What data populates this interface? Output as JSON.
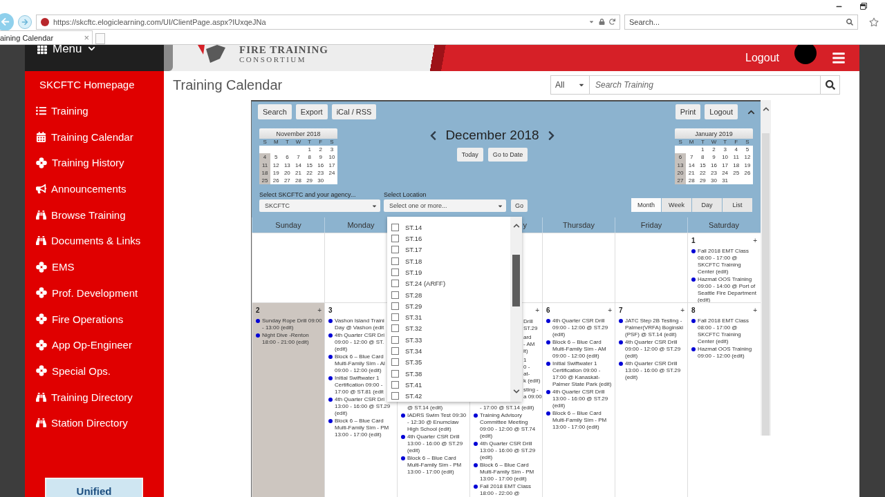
{
  "browser": {
    "url": "https://skcftc.elogiclearning.com/UI/ClientPage.aspx?IUxqeJNa",
    "search_placeholder": "Search...",
    "tab_title": "aining Calendar",
    "tab_close": "×"
  },
  "header": {
    "menu": "Menu",
    "logo_line1": "FIRE TRAINING",
    "logo_line2": "CONSORTIUM",
    "logout": "Logout"
  },
  "sidebar": {
    "items": [
      {
        "label": "SKCFTC Homepage",
        "kind": "plain"
      },
      {
        "label": "Training",
        "kind": "list"
      },
      {
        "label": "Training Calendar",
        "kind": "calendar"
      },
      {
        "label": "Training History",
        "kind": "cross"
      },
      {
        "label": "Announcements",
        "kind": "megaphone"
      },
      {
        "label": "Browse Training",
        "kind": "binoculars"
      },
      {
        "label": "Documents & Links",
        "kind": "binoculars"
      },
      {
        "label": "EMS",
        "kind": "cross"
      },
      {
        "label": "Prof. Development",
        "kind": "cross"
      },
      {
        "label": "Fire Operations",
        "kind": "cross"
      },
      {
        "label": "App Op-Engineer",
        "kind": "cross"
      },
      {
        "label": "Special Ops.",
        "kind": "cross"
      },
      {
        "label": "Training Directory",
        "kind": "binoculars"
      },
      {
        "label": "Station Directory",
        "kind": "binoculars"
      }
    ],
    "footer": "Unified"
  },
  "page": {
    "title": "Training Calendar",
    "scope": "All",
    "search_placeholder": "Search Training"
  },
  "calendar": {
    "toolbar_left": [
      "Search",
      "Export",
      "iCal / RSS"
    ],
    "toolbar_right": [
      "Print",
      "Logout"
    ],
    "month": "December 2018",
    "today": "Today",
    "goto": "Go to Date",
    "mini_calendars": [
      {
        "title": "November 2018",
        "weekdays": [
          "S",
          "M",
          "T",
          "W",
          "T",
          "F",
          "S"
        ],
        "weeks": [
          {
            "kind": "leading",
            "days": [
              "1",
              "2",
              "3"
            ]
          },
          {
            "shaded": true,
            "days": [
              "4",
              "5",
              "6",
              "7",
              "8",
              "9",
              "10"
            ]
          },
          {
            "shaded": true,
            "days": [
              "11",
              "12",
              "13",
              "14",
              "15",
              "16",
              "17"
            ]
          },
          {
            "shaded": true,
            "days": [
              "18",
              "19",
              "20",
              "21",
              "22",
              "23",
              "24"
            ]
          },
          {
            "shaded": true,
            "days": [
              "25",
              "26",
              "27",
              "28",
              "29",
              "30"
            ]
          }
        ]
      },
      {
        "title": "January 2019",
        "weekdays": [
          "S",
          "M",
          "T",
          "W",
          "T",
          "F",
          "S"
        ],
        "weeks": [
          {
            "kind": "leading",
            "days": [
              "1",
              "2",
              "3",
              "4",
              "5"
            ]
          },
          {
            "shaded": true,
            "days": [
              "6",
              "7",
              "8",
              "9",
              "10",
              "11",
              "12"
            ]
          },
          {
            "shaded": true,
            "days": [
              "13",
              "14",
              "15",
              "16",
              "17",
              "18",
              "19"
            ]
          },
          {
            "shaded": true,
            "days": [
              "20",
              "21",
              "22",
              "23",
              "24",
              "25",
              "26"
            ]
          },
          {
            "shaded": true,
            "days": [
              "27",
              "28",
              "29",
              "30",
              "31"
            ]
          }
        ]
      }
    ],
    "agency": {
      "label": "Select SKCFTC and your agency...",
      "value": "SKCFTC"
    },
    "location": {
      "label": "Select Location",
      "placeholder": "Select one or more..."
    },
    "go": "Go",
    "views": [
      {
        "label": "Month",
        "selected": true
      },
      {
        "label": "Week",
        "selected": false
      },
      {
        "label": "Day",
        "selected": false
      },
      {
        "label": "List",
        "selected": false
      }
    ],
    "day_headers": [
      {
        "label": "Sunday",
        "cut": false
      },
      {
        "label": "Monday",
        "cut": false
      },
      {
        "label": "y",
        "cut": true
      },
      {
        "label": "Thursday",
        "cut": false
      },
      {
        "label": "Friday",
        "cut": false
      },
      {
        "label": "Saturday",
        "cut": false
      }
    ],
    "weeks": [
      {
        "cells": [
          {},
          {},
          {},
          {},
          {},
          {},
          {
            "date": "1",
            "add": "+",
            "shaded": false,
            "events": [
              {
                "kind": "event",
                "lines": [
                  "Fall 2018 EMT Class",
                  "08:00 - 17:00 @",
                  "SKCFTC Training",
                  "Center (edit)"
                ]
              },
              {
                "kind": "event",
                "lines": [
                  "Hazmat OOS Training",
                  "09:00 - 14:00 @ Port of",
                  "Seattle Fire Department",
                  "(edit)"
                ]
              }
            ]
          }
        ]
      },
      {
        "cells": [
          {
            "date": "2",
            "add": "+",
            "shaded": true,
            "events": [
              {
                "kind": "event",
                "lines": [
                  "Sunday Rope Drill 09:00",
                  "- 13:00 (edit)"
                ]
              },
              {
                "kind": "event",
                "lines": [
                  "Night Dive -Renton",
                  "18:00 - 21:00 (edit)"
                ]
              }
            ]
          },
          {
            "date": "3",
            "shaded": false,
            "events": [
              {
                "kind": "event",
                "lines": [
                  "Vashon Island Traini",
                  "Day @ Vashon (edit"
                ]
              },
              {
                "kind": "event",
                "lines": [
                  "4th Quarter CSR Dri",
                  "09:00 - 12:00 @ ST.",
                  "(edit)"
                ]
              },
              {
                "kind": "event",
                "lines": [
                  "Block 6 – Blue Card",
                  "Multi-Family Sim - Al",
                  "09:00 - 12:00 (edit)"
                ]
              },
              {
                "kind": "event",
                "lines": [
                  "Initial Swiftwater 1",
                  "Certification 09:00 -",
                  "17:00 @ ST.81 (edit"
                ]
              },
              {
                "kind": "event",
                "lines": [
                  "4th Quarter CSR Dri",
                  "13:00 - 16:00 @ ST.29",
                  "(edit)"
                ]
              },
              {
                "kind": "event",
                "lines": [
                  "Block 6 – Blue Card",
                  "Multi-Family Sim - PM",
                  "13:00 - 17:00 (edit)"
                ]
              }
            ]
          },
          {
            "covered": true,
            "shaded": false,
            "events": [
              {
                "kind": "continuation",
                "lines": [
                  "@ ST.14 (edit)"
                ]
              },
              {
                "kind": "event",
                "lines": [
                  "IADRS Swim Test 09:30",
                  "- 12:30 @ Enumclaw",
                  "High School (edit)"
                ]
              },
              {
                "kind": "event",
                "lines": [
                  "4th Quarter CSR Drill",
                  "13:00 - 16:00 @ ST.29",
                  "(edit)"
                ]
              },
              {
                "kind": "event",
                "lines": [
                  "Block 6 – Blue Card",
                  "Multi-Family Sim - PM",
                  "13:00 - 17:00 (edit)"
                ]
              }
            ]
          },
          {
            "covered": true,
            "add": "+",
            "shaded": false,
            "fragments": [
              {
                "lines": [
                  "Drill",
                  "ST.29"
                ]
              },
              {
                "lines": [
                  "ard",
                  "- AM",
                  "it)"
                ]
              },
              {
                "lines": [
                  "1",
                  "0 -",
                  "at-",
                  "k (edit)"
                ]
              },
              {
                "lines": [
                  "sting -",
                  "a 09:00"
                ]
              }
            ],
            "events": [
              {
                "kind": "continuation",
                "lines": [
                  "- 17:00 @ ST.14 (edit)"
                ]
              },
              {
                "kind": "event",
                "lines": [
                  "Training Advisory",
                  "Committee Meeting",
                  "09:00 - 12:00 @ ST.74",
                  "(edit)"
                ]
              },
              {
                "kind": "event",
                "lines": [
                  "4th Quarter CSR Drill",
                  "13:00 - 16:00 @ ST.29",
                  "(edit)"
                ]
              },
              {
                "kind": "event",
                "lines": [
                  "Block 6 – Blue Card",
                  "Multi-Family Sim - PM",
                  "13:00 - 17:00 (edit)"
                ]
              },
              {
                "kind": "event",
                "lines": [
                  "Fall 2018 EMT Class",
                  "18:00 - 22:00 @"
                ]
              }
            ]
          },
          {
            "date": "6",
            "add": "+",
            "shaded": false,
            "events": [
              {
                "kind": "event",
                "lines": [
                  "4th Quarter CSR Drill",
                  "09:00 - 12:00 @ ST.29",
                  "(edit)"
                ]
              },
              {
                "kind": "event",
                "lines": [
                  "Block 6 – Blue Card",
                  "Multi-Family Sim - AM",
                  "09:00 - 12:00 (edit)"
                ]
              },
              {
                "kind": "event",
                "lines": [
                  "Initial Swiftwater 1",
                  "Certification 09:00 -",
                  "17:00 @ Kanaskat-",
                  "Palmer State Park (edit)"
                ]
              },
              {
                "kind": "event",
                "lines": [
                  "4th Quarter CSR Drill",
                  "13:00 - 16:00 @ ST.29",
                  "(edit)"
                ]
              },
              {
                "kind": "event",
                "lines": [
                  "Block 6 – Blue Card",
                  "Multi-Family Sim - PM",
                  "13:00 - 17:00 (edit)"
                ]
              }
            ]
          },
          {
            "date": "7",
            "add": "+",
            "shaded": false,
            "events": [
              {
                "kind": "event",
                "lines": [
                  "JATC Step 2B Testing -",
                  "Palmer(VRFA) Boginski",
                  "(PSF) @ ST.14 (edit)"
                ]
              },
              {
                "kind": "event",
                "lines": [
                  "4th Quarter CSR Drill",
                  "09:00 - 12:00 @ ST.29",
                  "(edit)"
                ]
              },
              {
                "kind": "event",
                "lines": [
                  "4th Quarter CSR Drill",
                  "13:00 - 16:00 @ ST.29",
                  "(edit)"
                ]
              }
            ]
          },
          {
            "date": "8",
            "add": "+",
            "shaded": false,
            "events": [
              {
                "kind": "event",
                "lines": [
                  "Fall 2018 EMT Class",
                  "08:00 - 17:00 @",
                  "SKCFTC Training",
                  "Center (edit)"
                ]
              },
              {
                "kind": "event",
                "lines": [
                  "Hazmat OOS Training",
                  "09:00 - 12:00 (edit)"
                ]
              }
            ]
          }
        ]
      }
    ],
    "location_dropdown": {
      "open": true,
      "options": [
        {
          "label": "ST.14",
          "checked": false
        },
        {
          "label": "ST.16",
          "checked": false
        },
        {
          "label": "ST.17",
          "checked": false
        },
        {
          "label": "ST.18",
          "checked": false
        },
        {
          "label": "ST.19",
          "checked": false
        },
        {
          "label": "ST.24 (ARFF)",
          "checked": false
        },
        {
          "label": "ST.28",
          "checked": false
        },
        {
          "label": "ST.29",
          "checked": false
        },
        {
          "label": "ST.31",
          "checked": false
        },
        {
          "label": "ST.32",
          "checked": false
        },
        {
          "label": "ST.33",
          "checked": false
        },
        {
          "label": "ST.34",
          "checked": false
        },
        {
          "label": "ST.35",
          "checked": false
        },
        {
          "label": "ST.38",
          "checked": false
        },
        {
          "label": "ST.41",
          "checked": false
        },
        {
          "label": "ST.42",
          "checked": false
        }
      ]
    }
  }
}
